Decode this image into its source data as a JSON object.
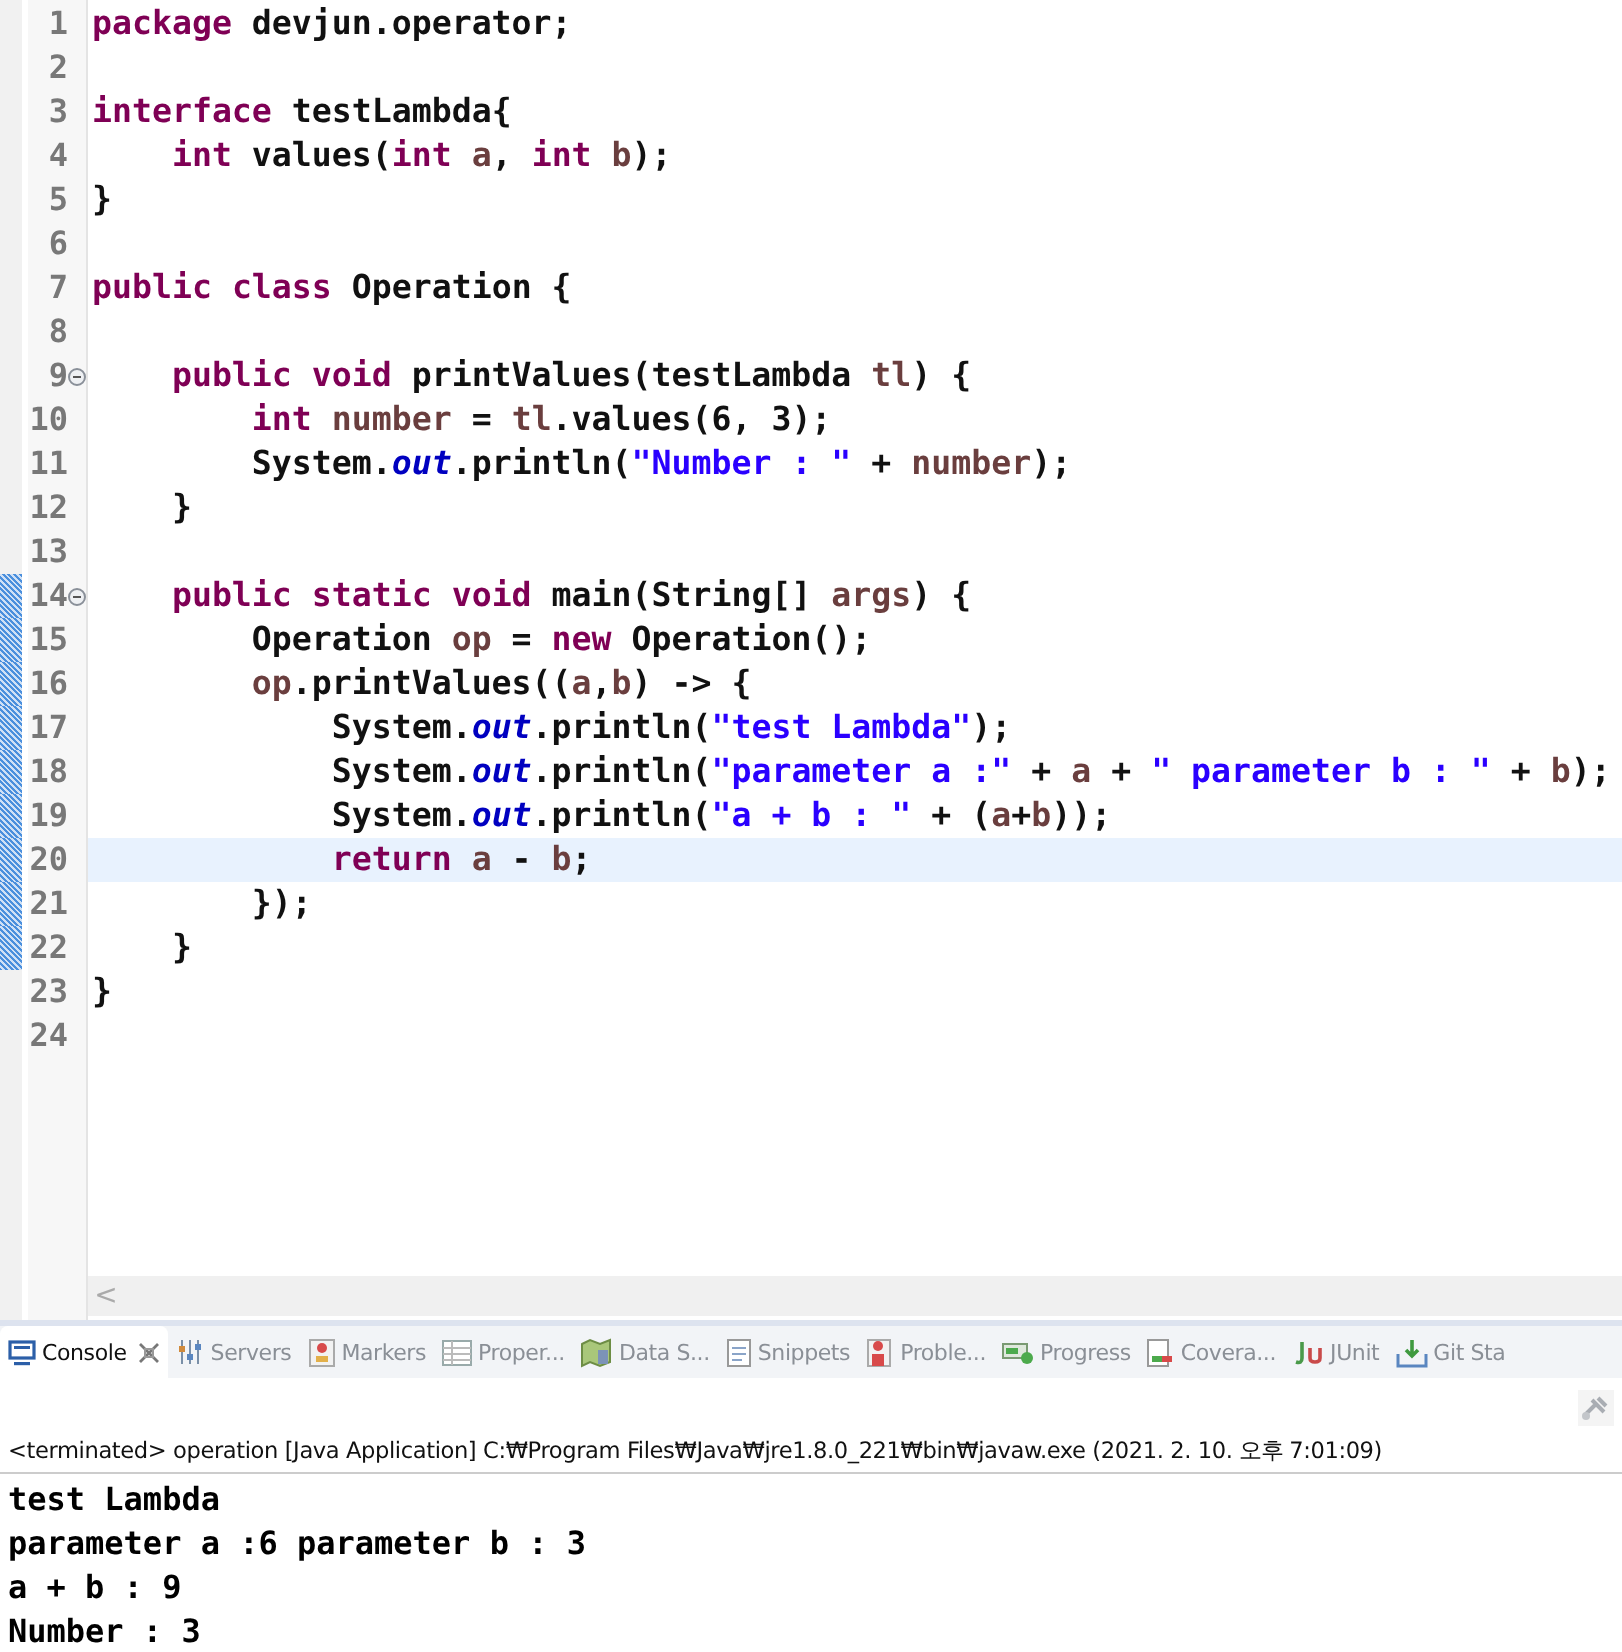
{
  "editor": {
    "lines": [
      {
        "number": "1",
        "fold": false,
        "current": false,
        "changed": false,
        "tokens": [
          {
            "kind": "kw",
            "text": "package"
          },
          {
            "kind": "plain",
            "text": " devjun.operator;"
          }
        ]
      },
      {
        "number": "2",
        "fold": false,
        "current": false,
        "changed": false
      },
      {
        "number": "3",
        "fold": false,
        "current": false,
        "changed": false,
        "tokens": [
          {
            "kind": "kw",
            "text": "interface"
          },
          {
            "kind": "plain",
            "text": " testLambda{"
          }
        ]
      },
      {
        "number": "4",
        "fold": false,
        "current": false,
        "changed": false,
        "tokens": [
          {
            "kind": "kw",
            "text": "    int"
          },
          {
            "kind": "plain",
            "text": " values("
          },
          {
            "kind": "kw",
            "text": "int"
          },
          {
            "kind": "var",
            "text": " a"
          },
          {
            "kind": "plain",
            "text": ", "
          },
          {
            "kind": "kw",
            "text": "int"
          },
          {
            "kind": "var",
            "text": " b"
          },
          {
            "kind": "plain",
            "text": ");"
          }
        ]
      },
      {
        "number": "5",
        "fold": false,
        "current": false,
        "changed": false,
        "tokens": [
          {
            "kind": "plain",
            "text": "}"
          }
        ]
      },
      {
        "number": "6",
        "fold": false,
        "current": false,
        "changed": false
      },
      {
        "number": "7",
        "fold": false,
        "current": false,
        "changed": false,
        "tokens": [
          {
            "kind": "kw",
            "text": "public"
          },
          {
            "kind": "kw",
            "text": " class"
          },
          {
            "kind": "plain",
            "text": " Operation {"
          }
        ]
      },
      {
        "number": "8",
        "fold": false,
        "current": false,
        "changed": false
      },
      {
        "number": "9",
        "fold": true,
        "current": false,
        "changed": false,
        "tokens": [
          {
            "kind": "kw",
            "text": "    public"
          },
          {
            "kind": "kw",
            "text": " void"
          },
          {
            "kind": "plain",
            "text": " printValues(testLambda "
          },
          {
            "kind": "var",
            "text": "tl"
          },
          {
            "kind": "plain",
            "text": ") {"
          }
        ]
      },
      {
        "number": "10",
        "fold": false,
        "current": false,
        "changed": false,
        "tokens": [
          {
            "kind": "kw",
            "text": "        int"
          },
          {
            "kind": "var",
            "text": " number"
          },
          {
            "kind": "plain",
            "text": " = "
          },
          {
            "kind": "var",
            "text": "tl"
          },
          {
            "kind": "plain",
            "text": ".values(6, 3);"
          }
        ]
      },
      {
        "number": "11",
        "fold": false,
        "current": false,
        "changed": false,
        "tokens": [
          {
            "kind": "plain",
            "text": "        System."
          },
          {
            "kind": "field",
            "text": "out"
          },
          {
            "kind": "plain",
            "text": ".println("
          },
          {
            "kind": "str",
            "text": "\"Number : \""
          },
          {
            "kind": "plain",
            "text": " + "
          },
          {
            "kind": "var",
            "text": "number"
          },
          {
            "kind": "plain",
            "text": ");"
          }
        ]
      },
      {
        "number": "12",
        "fold": false,
        "current": false,
        "changed": false,
        "tokens": [
          {
            "kind": "plain",
            "text": "    }"
          }
        ]
      },
      {
        "number": "13",
        "fold": false,
        "current": false,
        "changed": false
      },
      {
        "number": "14",
        "fold": true,
        "current": false,
        "changed": true,
        "tokens": [
          {
            "kind": "kw",
            "text": "    public"
          },
          {
            "kind": "kw",
            "text": " static"
          },
          {
            "kind": "kw",
            "text": " void"
          },
          {
            "kind": "plain",
            "text": " main(String[] "
          },
          {
            "kind": "var",
            "text": "args"
          },
          {
            "kind": "plain",
            "text": ") {"
          }
        ]
      },
      {
        "number": "15",
        "fold": false,
        "current": false,
        "changed": true,
        "tokens": [
          {
            "kind": "plain",
            "text": "        Operation "
          },
          {
            "kind": "var",
            "text": "op"
          },
          {
            "kind": "plain",
            "text": " = "
          },
          {
            "kind": "kw",
            "text": "new"
          },
          {
            "kind": "plain",
            "text": " Operation();"
          }
        ]
      },
      {
        "number": "16",
        "fold": false,
        "current": false,
        "changed": true,
        "tokens": [
          {
            "kind": "var",
            "text": "        op"
          },
          {
            "kind": "plain",
            "text": ".printValues(("
          },
          {
            "kind": "var",
            "text": "a"
          },
          {
            "kind": "plain",
            "text": ","
          },
          {
            "kind": "var",
            "text": "b"
          },
          {
            "kind": "plain",
            "text": ") -> {"
          }
        ]
      },
      {
        "number": "17",
        "fold": false,
        "current": false,
        "changed": true,
        "tokens": [
          {
            "kind": "plain",
            "text": "            System."
          },
          {
            "kind": "field",
            "text": "out"
          },
          {
            "kind": "plain",
            "text": ".println("
          },
          {
            "kind": "str",
            "text": "\"test Lambda\""
          },
          {
            "kind": "plain",
            "text": ");"
          }
        ]
      },
      {
        "number": "18",
        "fold": false,
        "current": false,
        "changed": true,
        "tokens": [
          {
            "kind": "plain",
            "text": "            System."
          },
          {
            "kind": "field",
            "text": "out"
          },
          {
            "kind": "plain",
            "text": ".println("
          },
          {
            "kind": "str",
            "text": "\"parameter a :\""
          },
          {
            "kind": "plain",
            "text": " + "
          },
          {
            "kind": "var",
            "text": "a"
          },
          {
            "kind": "plain",
            "text": " + "
          },
          {
            "kind": "str",
            "text": "\" parameter b : \""
          },
          {
            "kind": "plain",
            "text": " + "
          },
          {
            "kind": "var",
            "text": "b"
          },
          {
            "kind": "plain",
            "text": ");"
          }
        ]
      },
      {
        "number": "19",
        "fold": false,
        "current": false,
        "changed": true,
        "tokens": [
          {
            "kind": "plain",
            "text": "            System."
          },
          {
            "kind": "field",
            "text": "out"
          },
          {
            "kind": "plain",
            "text": ".println("
          },
          {
            "kind": "str",
            "text": "\"a + b : \""
          },
          {
            "kind": "plain",
            "text": " + ("
          },
          {
            "kind": "var",
            "text": "a"
          },
          {
            "kind": "plain",
            "text": "+"
          },
          {
            "kind": "var",
            "text": "b"
          },
          {
            "kind": "plain",
            "text": "));"
          }
        ]
      },
      {
        "number": "20",
        "fold": false,
        "current": true,
        "changed": true,
        "tokens": [
          {
            "kind": "kw",
            "text": "            return"
          },
          {
            "kind": "var",
            "text": " a"
          },
          {
            "kind": "plain",
            "text": " - "
          },
          {
            "kind": "var",
            "text": "b"
          },
          {
            "kind": "plain",
            "text": ";"
          }
        ]
      },
      {
        "number": "21",
        "fold": false,
        "current": false,
        "changed": true,
        "tokens": [
          {
            "kind": "plain",
            "text": "        });"
          }
        ]
      },
      {
        "number": "22",
        "fold": false,
        "current": false,
        "changed": true,
        "tokens": [
          {
            "kind": "plain",
            "text": "    }"
          }
        ]
      },
      {
        "number": "23",
        "fold": false,
        "current": false,
        "changed": false,
        "tokens": [
          {
            "kind": "plain",
            "text": "}"
          }
        ]
      },
      {
        "number": "24",
        "fold": false,
        "current": false,
        "changed": false
      }
    ],
    "scroll_left": "<"
  },
  "panel": {
    "tabs": [
      {
        "label": "Console",
        "selected": true
      },
      {
        "label": "Servers",
        "selected": false
      },
      {
        "label": "Markers",
        "selected": false
      },
      {
        "label": "Proper...",
        "selected": false
      },
      {
        "label": "Data S...",
        "selected": false
      },
      {
        "label": "Snippets",
        "selected": false
      },
      {
        "label": "Proble...",
        "selected": false
      },
      {
        "label": "Progress",
        "selected": false
      },
      {
        "label": "Covera...",
        "selected": false
      },
      {
        "label": "JUnit",
        "selected": false
      },
      {
        "label": "Git Sta",
        "selected": false
      }
    ],
    "status": "<terminated> operation [Java Application] C:₩Program Files₩Java₩jre1.8.0_221₩bin₩javaw.exe (2021. 2. 10. 오후 7:01:09)",
    "output": [
      "test Lambda",
      "parameter a :6 parameter b : 3",
      "a + b : 9",
      "Number : 3"
    ]
  }
}
